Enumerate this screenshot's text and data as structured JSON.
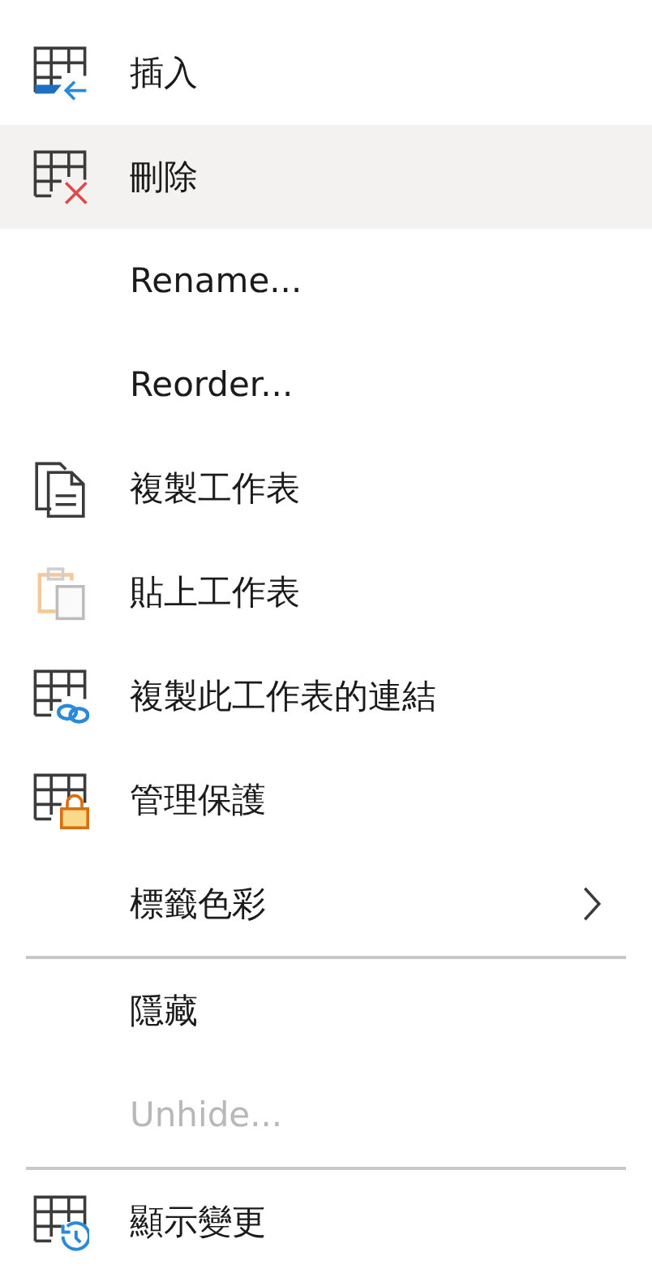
{
  "menu": {
    "items": [
      {
        "kind": "insert",
        "label": "插入",
        "selected": false,
        "disabled": false
      },
      {
        "kind": "delete",
        "label": "刪除",
        "selected": true,
        "disabled": false
      },
      {
        "kind": "text",
        "label": "Rename...",
        "selected": false,
        "disabled": false
      },
      {
        "kind": "text",
        "label": "Reorder...",
        "selected": false,
        "disabled": false
      },
      {
        "kind": "copy",
        "label": "複製工作表",
        "selected": false,
        "disabled": false
      },
      {
        "kind": "paste",
        "label": "貼上工作表",
        "selected": false,
        "disabled": false
      },
      {
        "kind": "link",
        "label": "複製此工作表的連結",
        "selected": false,
        "disabled": false
      },
      {
        "kind": "protect",
        "label": "管理保護",
        "selected": false,
        "disabled": false
      },
      {
        "kind": "submenu",
        "label": "標籤色彩",
        "selected": false,
        "disabled": false
      },
      {
        "kind": "separator"
      },
      {
        "kind": "text",
        "label": "隱藏",
        "selected": false,
        "disabled": false
      },
      {
        "kind": "text",
        "label": "Unhide...",
        "selected": false,
        "disabled": true
      },
      {
        "kind": "separator"
      },
      {
        "kind": "history",
        "label": "顯示變更",
        "selected": false,
        "disabled": false
      }
    ]
  }
}
